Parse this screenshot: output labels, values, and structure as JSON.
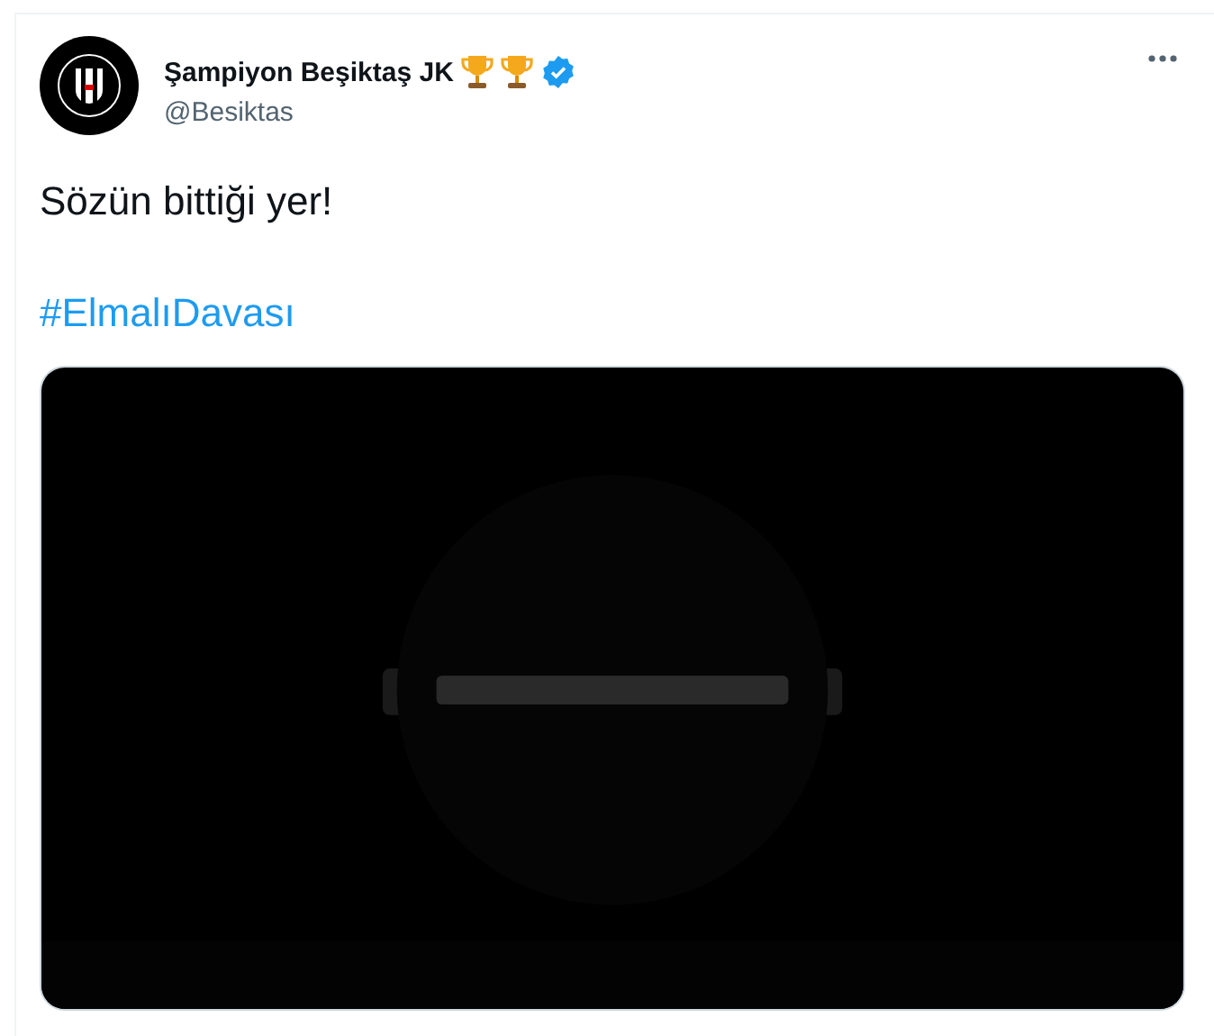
{
  "author": {
    "name": "Şampiyon Beşiktaş JK",
    "handle": "@Besiktas",
    "verified": true
  },
  "text": "Sözün bittiği yer!",
  "hashtag": "#ElmalıDavası"
}
